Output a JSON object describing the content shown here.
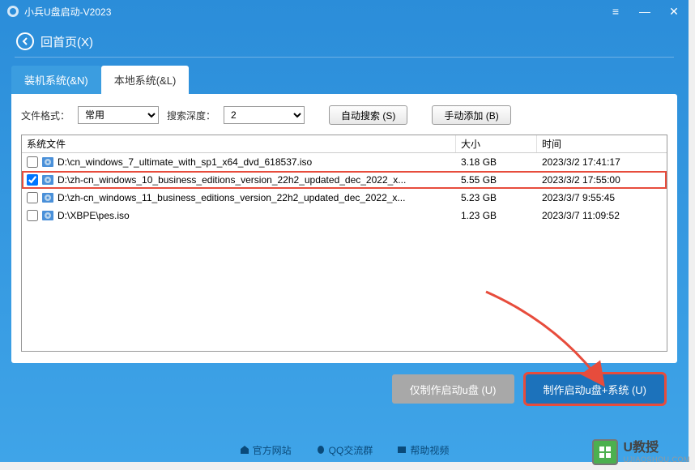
{
  "titlebar": {
    "title": "小兵U盘启动-V2023"
  },
  "nav": {
    "back_label": "回首页(X)"
  },
  "tabs": {
    "install": "装机系统(&N)",
    "local": "本地系统(&L)"
  },
  "filters": {
    "format_label": "文件格式：",
    "format_value": "常用",
    "depth_label": "搜索深度：",
    "depth_value": "2",
    "auto_search": "自动搜索 (S)",
    "manual_add": "手动添加 (B)"
  },
  "table": {
    "headers": {
      "file": "系统文件",
      "size": "大小",
      "time": "时间"
    },
    "rows": [
      {
        "checked": false,
        "path": "D:\\cn_windows_7_ultimate_with_sp1_x64_dvd_618537.iso",
        "size": "3.18 GB",
        "time": "2023/3/2 17:41:17"
      },
      {
        "checked": true,
        "highlight": true,
        "path": "D:\\zh-cn_windows_10_business_editions_version_22h2_updated_dec_2022_x...",
        "size": "5.55 GB",
        "time": "2023/3/2 17:55:00"
      },
      {
        "checked": false,
        "path": "D:\\zh-cn_windows_11_business_editions_version_22h2_updated_dec_2022_x...",
        "size": "5.23 GB",
        "time": "2023/3/7 9:55:45"
      },
      {
        "checked": false,
        "path": "D:\\XBPE\\pes.iso",
        "size": "1.23 GB",
        "time": "2023/3/7 11:09:52"
      }
    ]
  },
  "footer": {
    "make_only": "仅制作启动u盘 (U)",
    "make_system": "制作启动u盘+系统 (U)"
  },
  "bottom_links": {
    "official": "官方网站",
    "qq": "QQ交流群",
    "tutorial": "帮助视频"
  },
  "watermark": {
    "name": "U教授",
    "url": "UJIAOSHOU.COM"
  }
}
